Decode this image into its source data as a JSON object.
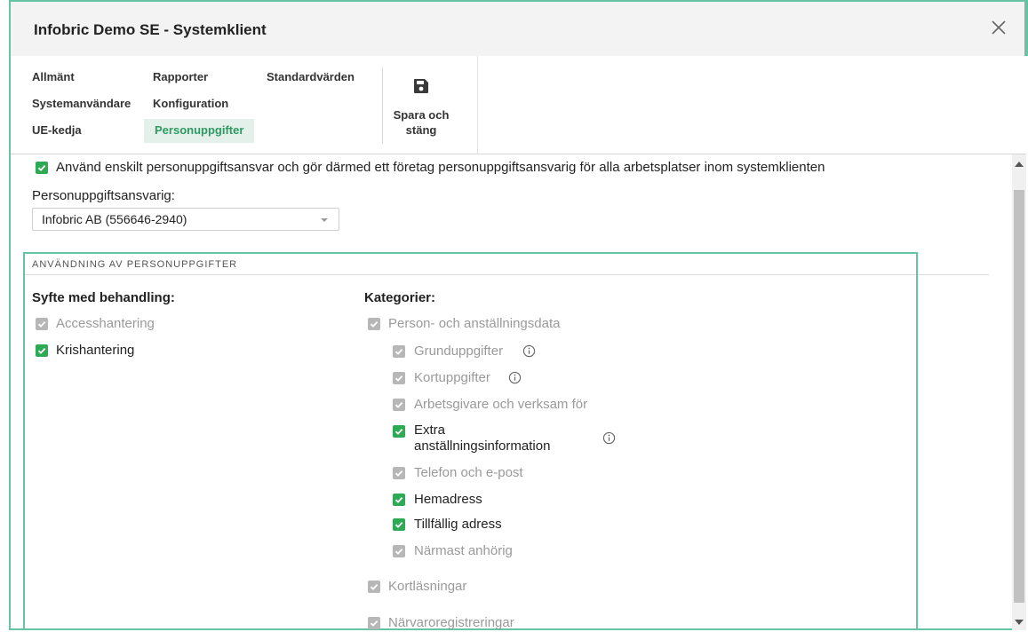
{
  "window": {
    "title": "Infobric Demo SE - Systemklient"
  },
  "nav": {
    "col1": [
      "Allmänt",
      "Systemanvändare",
      "UE-kedja"
    ],
    "col2": [
      "Rapporter",
      "Konfiguration",
      "Personuppgifter"
    ],
    "col3": [
      "Standardvärden"
    ],
    "active": "Personuppgifter"
  },
  "toolbar": {
    "save_line1": "Spara och",
    "save_line2": "stäng",
    "save_icon": "floppy-disk-icon"
  },
  "settings": {
    "single_responsibility_label": "Använd enskilt personuppgiftsansvar och gör därmed ett företag personuppgiftsansvarig för alla arbetsplatser inom systemklienten",
    "single_responsibility_checked": true,
    "controller_label": "Personuppgiftsansvarig:",
    "controller_value": "Infobric AB (556646-2940)"
  },
  "usage": {
    "title": "ANVÄNDNING AV PERSONUPPGIFTER",
    "purpose_heading": "Syfte med behandling:",
    "purposes": [
      {
        "label": "Accesshantering",
        "checked": true,
        "enabled": false
      },
      {
        "label": "Krishantering",
        "checked": true,
        "enabled": true
      }
    ],
    "categories_heading": "Kategorier:",
    "categories": {
      "person": {
        "label": "Person- och anställningsdata",
        "checked": true,
        "enabled": false
      },
      "sub": [
        {
          "label": "Grunduppgifter",
          "checked": true,
          "enabled": false,
          "info": true
        },
        {
          "label": "Kortuppgifter",
          "checked": true,
          "enabled": false,
          "info": true
        },
        {
          "label": "Arbetsgivare och verksam för",
          "checked": true,
          "enabled": false
        },
        {
          "label": "Extra",
          "label2": "anställningsinformation",
          "checked": true,
          "enabled": true,
          "info": true
        },
        {
          "label": "Telefon och e-post",
          "checked": true,
          "enabled": false
        },
        {
          "label": "Hemadress",
          "checked": true,
          "enabled": true
        },
        {
          "label": "Tillfällig adress",
          "checked": true,
          "enabled": true
        },
        {
          "label": "Närmast anhörig",
          "checked": true,
          "enabled": false
        }
      ],
      "card_reads": {
        "label": "Kortläsningar",
        "checked": true,
        "enabled": false
      },
      "attendance": {
        "label": "Närvaroregistreringar",
        "checked": true,
        "enabled": false
      }
    }
  },
  "colors": {
    "accent": "#64c4a4",
    "checked_enabled": "#2eaa55",
    "checked_disabled": "#b7b7b7",
    "active_tab_bg": "#e3f1ea",
    "active_tab_text": "#2e9a62"
  }
}
